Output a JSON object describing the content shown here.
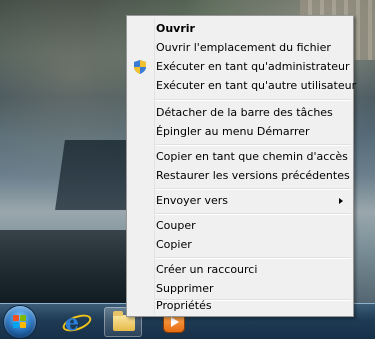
{
  "taskbar": {
    "start_icon": "windows-start-orb",
    "pinned": [
      "internet-explorer-icon",
      "windows-explorer-icon",
      "media-player-icon"
    ]
  },
  "context_menu": {
    "items": [
      {
        "label": "Ouvrir",
        "bold": true
      },
      {
        "label": "Ouvrir l'emplacement du fichier"
      },
      {
        "label": "Exécuter en tant qu'administrateur",
        "icon": "uac-shield-icon"
      },
      {
        "label": "Exécuter en tant qu'autre utilisateur"
      },
      {
        "label": "Détacher de la barre des tâches"
      },
      {
        "label": "Épingler au menu Démarrer"
      },
      {
        "label": "Copier en tant que chemin d'accès"
      },
      {
        "label": "Restaurer les versions précédentes"
      },
      {
        "label": "Envoyer vers",
        "submenu": true
      },
      {
        "label": "Couper"
      },
      {
        "label": "Copier"
      },
      {
        "label": "Créer un raccourci"
      },
      {
        "label": "Supprimer"
      },
      {
        "label": "Propriétés"
      }
    ]
  }
}
